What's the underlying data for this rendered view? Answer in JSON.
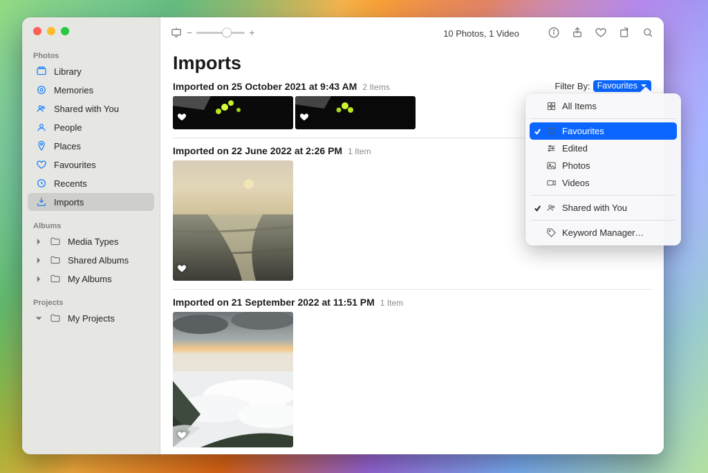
{
  "window": {
    "summary": "10 Photos, 1 Video"
  },
  "sidebar": {
    "sections": [
      {
        "title": "Photos",
        "items": [
          {
            "label": "Library"
          },
          {
            "label": "Memories"
          },
          {
            "label": "Shared with You"
          },
          {
            "label": "People"
          },
          {
            "label": "Places"
          },
          {
            "label": "Favourites"
          },
          {
            "label": "Recents"
          },
          {
            "label": "Imports",
            "selected": true
          }
        ]
      },
      {
        "title": "Albums",
        "items": [
          {
            "label": "Media Types",
            "disclosure": true
          },
          {
            "label": "Shared Albums",
            "disclosure": true
          },
          {
            "label": "My Albums",
            "disclosure": true
          }
        ]
      },
      {
        "title": "Projects",
        "items": [
          {
            "label": "My Projects",
            "disclosure": true,
            "disclosure_open": true
          }
        ]
      }
    ]
  },
  "page": {
    "title": "Imports",
    "filter_label": "Filter By:",
    "filter_value": "Favourites"
  },
  "groups": [
    {
      "date": "Imported on 25 October 2021 at 9:43 AM",
      "count": "2 Items"
    },
    {
      "date": "Imported on 22 June 2022 at 2:26 PM",
      "count": "1 Item"
    },
    {
      "date": "Imported on 21 September 2022 at 11:51 PM",
      "count": "1 Item"
    }
  ],
  "menu": {
    "items": [
      {
        "label": "All Items",
        "icon": "grid"
      },
      {
        "label": "Favourites",
        "icon": "heart",
        "checked": true,
        "highlight": true
      },
      {
        "label": "Edited",
        "icon": "sliders"
      },
      {
        "label": "Photos",
        "icon": "photo"
      },
      {
        "label": "Videos",
        "icon": "video"
      },
      {
        "label": "Shared with You",
        "icon": "people",
        "checked": true
      },
      {
        "label": "Keyword Manager…",
        "icon": "tag"
      }
    ]
  }
}
